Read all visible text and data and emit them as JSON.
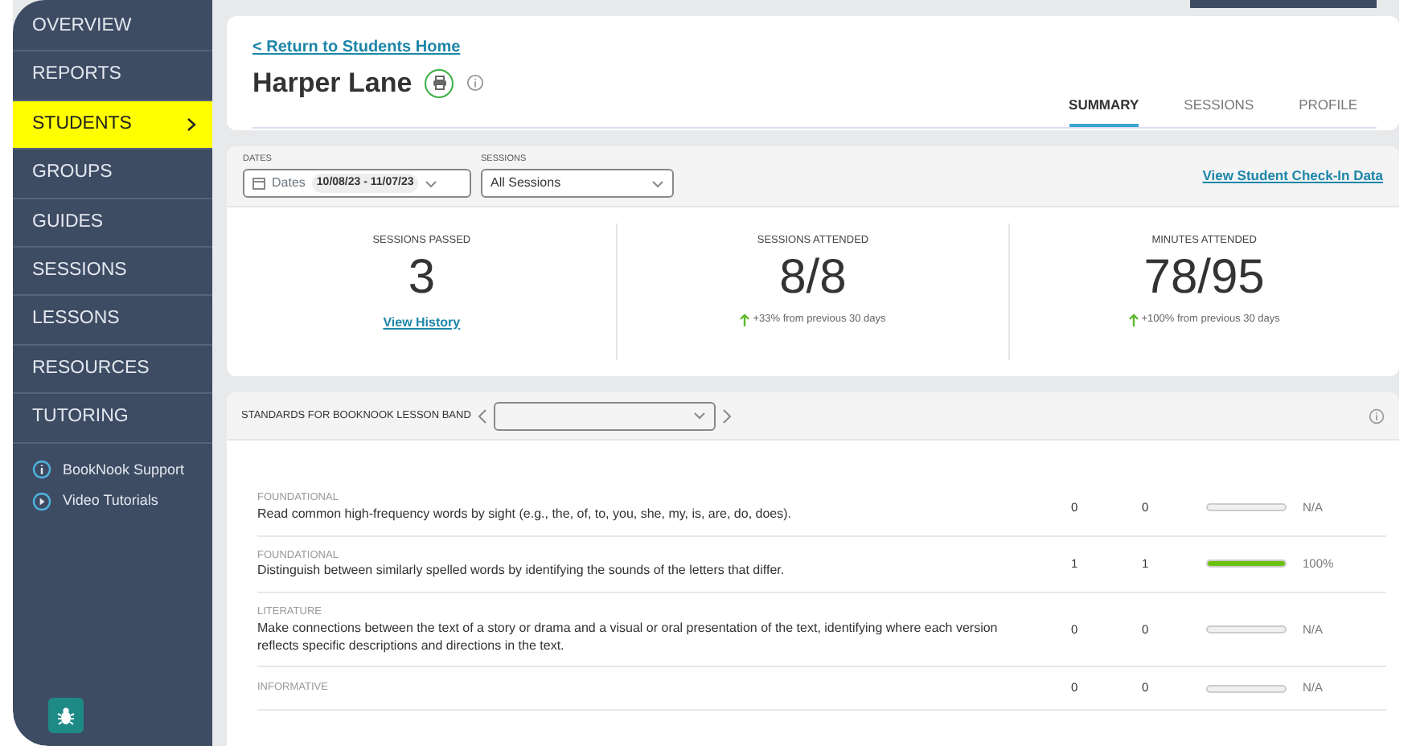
{
  "sidebar": {
    "items": [
      {
        "label": "OVERVIEW",
        "selected": false
      },
      {
        "label": "REPORTS",
        "selected": false
      },
      {
        "label": "STUDENTS",
        "selected": true
      },
      {
        "label": "GROUPS",
        "selected": false
      },
      {
        "label": "GUIDES",
        "selected": false
      },
      {
        "label": "SESSIONS",
        "selected": false
      },
      {
        "label": "LESSONS",
        "selected": false
      },
      {
        "label": "RESOURCES",
        "selected": false
      },
      {
        "label": "TUTORING",
        "selected": false
      }
    ],
    "links": [
      {
        "kind": "info",
        "label": "BookNook Support"
      },
      {
        "kind": "play",
        "label": "Video Tutorials"
      }
    ]
  },
  "header": {
    "back_link": "< Return to Students Home",
    "student_name": "Harper Lane",
    "tabs": [
      {
        "label": "SUMMARY",
        "selected": true
      },
      {
        "label": "SESSIONS",
        "selected": false
      },
      {
        "label": "PROFILE",
        "selected": false
      }
    ]
  },
  "filters": {
    "dates": {
      "label": "DATES",
      "prefix": "Dates",
      "value": "10/08/23 - 11/07/23"
    },
    "sessions": {
      "label": "SESSIONS",
      "value": "All Sessions"
    },
    "link": "View Student Check-In Data"
  },
  "stats": [
    {
      "title": "SESSIONS PASSED",
      "value": "3",
      "link": "View History"
    },
    {
      "title": "SESSIONS ATTENDED",
      "value": "8/8",
      "change": "+33% from previous 30 days"
    },
    {
      "title": "MINUTES ATTENDED",
      "value": "78/95",
      "change": "+100% from previous 30 days"
    }
  ],
  "standards": {
    "title": "STANDARDS FOR BOOKNOOK LESSON BAND",
    "rows": [
      {
        "category": "FOUNDATIONAL",
        "description": "Read common high-frequency words by sight (e.g., the, of, to, you, she, my, is, are, do, does).",
        "column_2": "0",
        "column_3": "0",
        "level": 0,
        "reading": "N/A"
      },
      {
        "category": "FOUNDATIONAL",
        "description": "Distinguish between similarly spelled words by identifying the sounds of the letters that differ.",
        "column_2": "1",
        "column_3": "1",
        "level": 1,
        "reading": "100%"
      },
      {
        "category": "LITERATURE",
        "description": "Make connections between the text of a story or drama and a visual or oral presentation of the text, identifying where each version reflects specific descriptions and directions in the text.",
        "column_2": "0",
        "column_3": "0",
        "level": 0,
        "reading": "N/A"
      },
      {
        "category": "INFORMATIVE",
        "column_2": "0",
        "column_3": "0",
        "level": 0,
        "reading": "N/A"
      }
    ]
  }
}
